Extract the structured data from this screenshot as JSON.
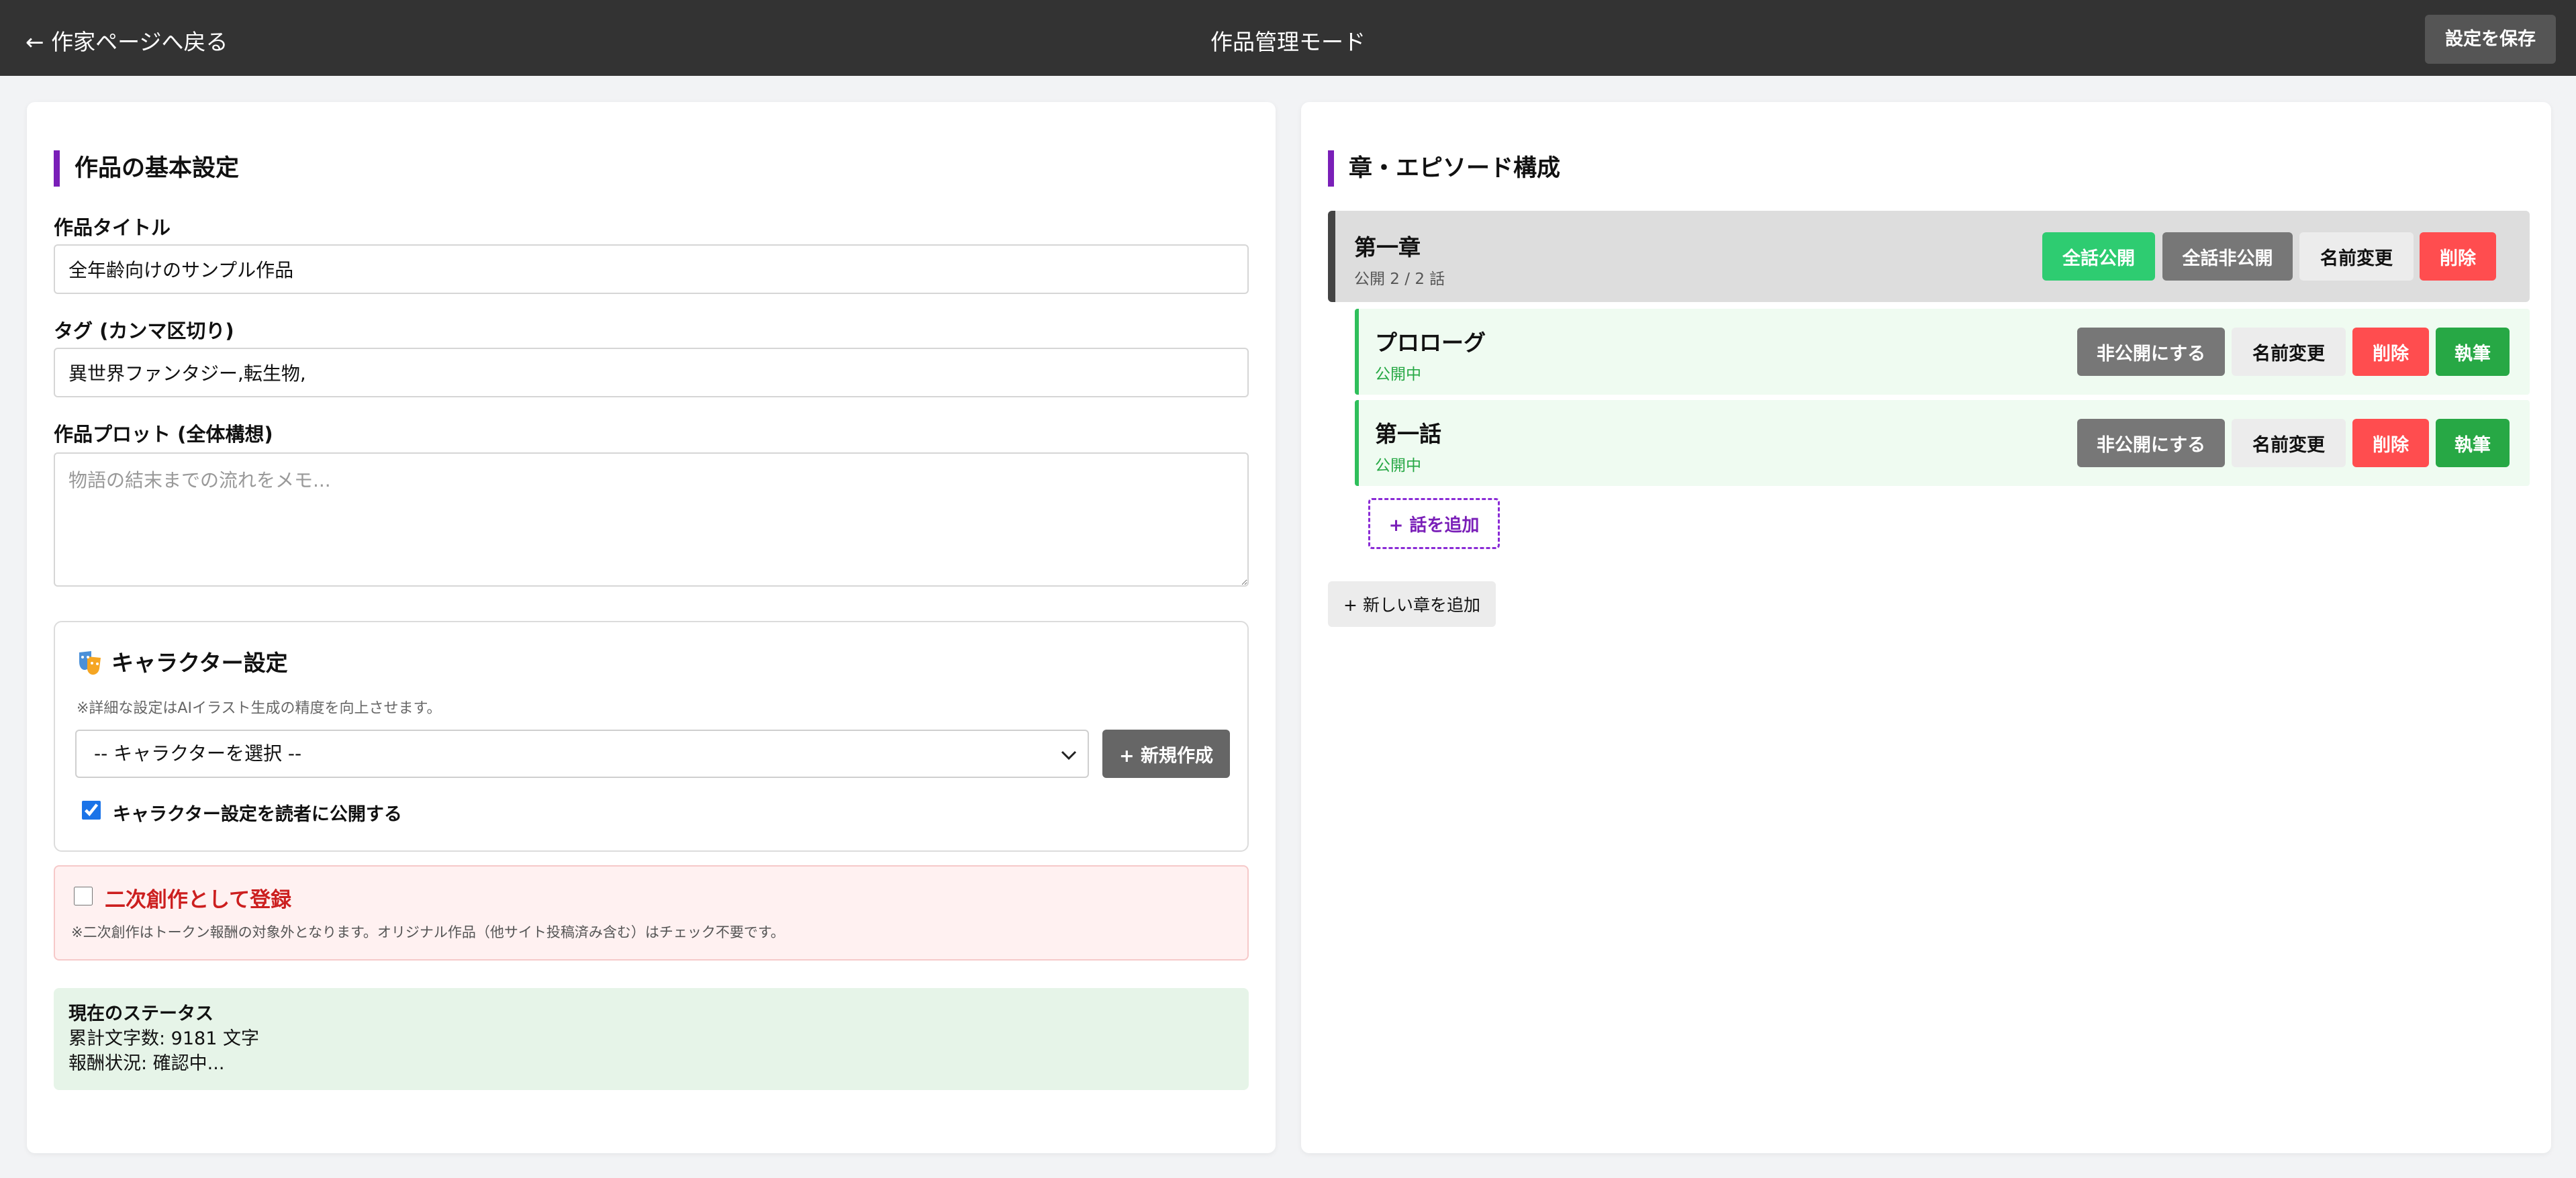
{
  "header": {
    "back_link": "← 作家ページへ戻る",
    "title": "作品管理モード",
    "save_button": "設定を保存"
  },
  "basic": {
    "section_title": "作品の基本設定",
    "title_label": "作品タイトル",
    "title_value": "全年齢向けのサンプル作品",
    "tags_label": "タグ (カンマ区切り)",
    "tags_value": "異世界ファンタジー,転生物,",
    "plot_label": "作品プロット (全体構想)",
    "plot_placeholder": "物語の結末までの流れをメモ..."
  },
  "character": {
    "icon": "theater-masks-icon",
    "title": "キャラクター設定",
    "note": "※詳細な設定はAIイラスト生成の精度を向上させます。",
    "select_value": "-- キャラクターを選択 --",
    "new_button": "+ 新規作成",
    "publish_label": "キャラクター設定を読者に公開する",
    "publish_checked": true
  },
  "derivative": {
    "label": "二次創作として登録",
    "checked": false,
    "note": "※二次創作はトークン報酬の対象外となります。オリジナル作品（他サイト投稿済み含む）はチェック不要です。"
  },
  "status": {
    "title": "現在のステータス",
    "char_count": "累計文字数: 9181 文字",
    "reward": "報酬状況: 確認中..."
  },
  "structure": {
    "section_title": "章・エピソード構成",
    "chapter": {
      "name": "第一章",
      "sub": "公開 2 / 2 話",
      "publish_all": "全話公開",
      "unpublish_all": "全話非公開",
      "rename": "名前変更",
      "delete": "削除"
    },
    "episodes": [
      {
        "name": "プロローグ",
        "status": "公開中",
        "unpublish": "非公開にする",
        "rename": "名前変更",
        "delete": "削除",
        "write": "執筆"
      },
      {
        "name": "第一話",
        "status": "公開中",
        "unpublish": "非公開にする",
        "rename": "名前変更",
        "delete": "削除",
        "write": "執筆"
      }
    ],
    "add_episode": "+ 話を追加",
    "add_chapter": "+ 新しい章を追加"
  },
  "colors": {
    "header_bg": "#333333",
    "accent_purple": "#7a1fb8",
    "publish_green": "#2ecc71",
    "write_green": "#27a845",
    "delete_red": "#ff4d4f",
    "derivative_red": "#cc1f1f",
    "status_bg": "#e6f4e8"
  }
}
